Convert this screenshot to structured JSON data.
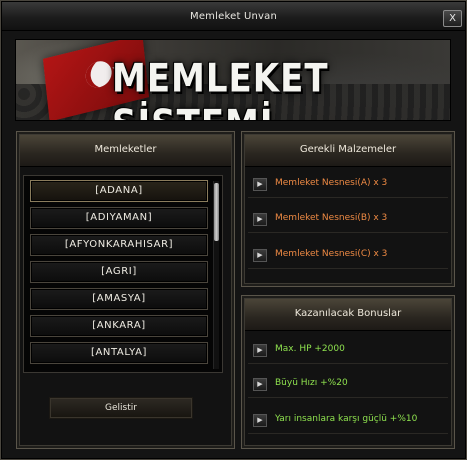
{
  "window": {
    "title": "Memleket Unvan",
    "close_label": "X"
  },
  "banner": {
    "logo_text": "MEMLEKET SİSTEMİ",
    "flag_star": "★"
  },
  "cities_panel": {
    "title": "Memleketler",
    "items": [
      "[ADANA]",
      "[ADIYAMAN]",
      "[AFYONKARAHISAR]",
      "[AGRI]",
      "[AMASYA]",
      "[ANKARA]",
      "[ANTALYA]"
    ],
    "selected_index": 0,
    "develop_button": "Gelistir"
  },
  "requirements_panel": {
    "title": "Gerekli Malzemeler",
    "items": [
      "Memleket Nesnesi(A) x 3",
      "Memleket Nesnesi(B) x 3",
      "Memleket Nesnesi(C) x 3"
    ]
  },
  "bonuses_panel": {
    "title": "Kazanılacak Bonuslar",
    "items": [
      "Max. HP +2000",
      "Büyü Hızı +%20",
      "Yarı insanlara karşı güçlü +%10"
    ]
  },
  "icons": {
    "arrow": "▶"
  },
  "colors": {
    "requirement_text": "#ee8a44",
    "bonus_text": "#8fe24f"
  }
}
